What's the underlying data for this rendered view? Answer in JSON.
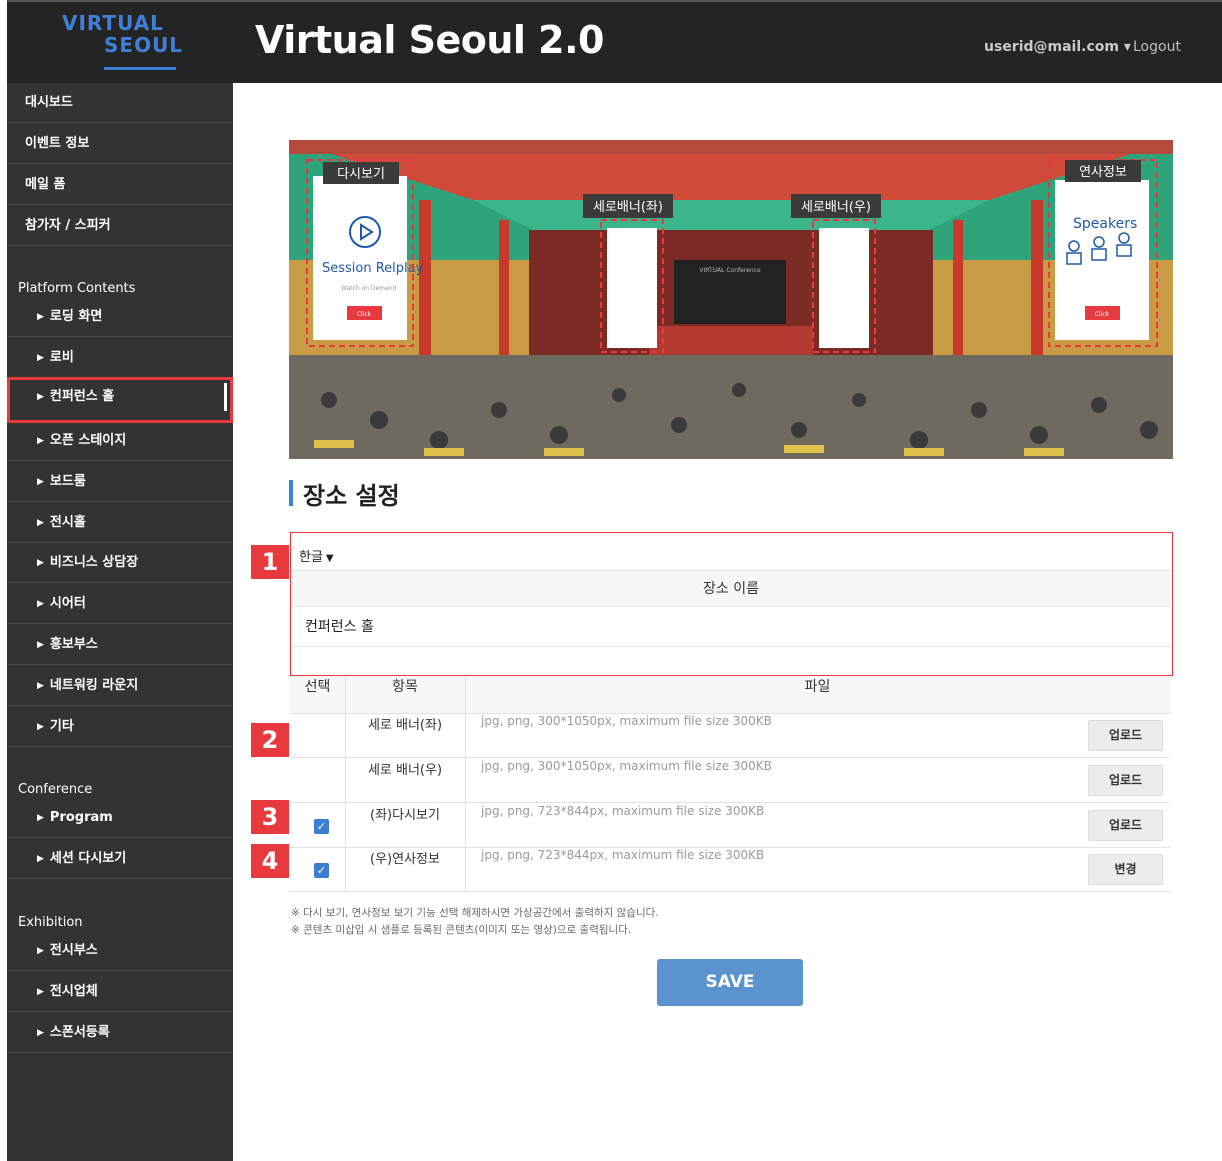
{
  "header": {
    "logo_line1": "VIRTUAL",
    "logo_line2": "SEOUL",
    "title": "Virtual Seoul 2.0",
    "user": "userid@mail.com ▾",
    "logout": "Logout"
  },
  "sidebar": {
    "top_items": [
      "대시보드",
      "이벤트 정보",
      "메일 폼",
      "참가자 / 스피커"
    ],
    "sections": [
      "Platform Contents",
      "Conference",
      "Exhibition"
    ],
    "platform_items": [
      "로딩 화면",
      "로비",
      "컨퍼런스 홀",
      "오픈 스테이지",
      "보드룸",
      "전시홀",
      "비즈니스 상담장",
      "시어터",
      "홍보부스",
      "네트워킹 라운지",
      "기타"
    ],
    "conference_items": [
      "Program",
      "세션 다시보기"
    ],
    "exhibition_items": [
      "전시부스",
      "전시업체",
      "스폰서등록"
    ],
    "active_item": "컨퍼런스 홀"
  },
  "banner": {
    "left_label": "다시보기",
    "right_label": "연사정보",
    "banner_left_label": "세로배너(좌)",
    "banner_right_label": "세로배너(우)",
    "replay_text": "Session Relplay",
    "replay_sub": "Watch on Demand",
    "click": "Click",
    "speakers_text": "Speakers",
    "screen_text": "VIRTUAL Conference"
  },
  "page": {
    "heading": "장소 설정",
    "language": "한글",
    "name_header": "장소 이름",
    "name_value": "컨퍼런스 홀"
  },
  "markers": [
    "1",
    "2",
    "3",
    "4"
  ],
  "table": {
    "headers": [
      "선택",
      "항목",
      "파일"
    ],
    "rows": [
      {
        "item": "세로 배너(좌)",
        "file": "jpg, png, 300*1050px, maximum file size 300KB",
        "button": "업로드",
        "checked": false
      },
      {
        "item": "세로 배너(우)",
        "file": "jpg, png, 300*1050px, maximum file size 300KB",
        "button": "업로드",
        "checked": false
      },
      {
        "item": "(좌)다시보기",
        "file": "jpg, png, 723*844px, maximum file size 300KB",
        "button": "업로드",
        "checked": true
      },
      {
        "item": "(우)연사정보",
        "file": "jpg, png, 723*844px, maximum file size 300KB",
        "button": "변경",
        "checked": true
      }
    ]
  },
  "notes": [
    "※  다시 보기, 연사정보 보기 기능 선택 해제하시면 가상공간에서 출력하지 않습니다.",
    "※  콘텐츠 미삽입 시 샘플로 등록된 콘텐츠(이미지 또는 영상)으로 출력됩니다."
  ],
  "save_label": "SAVE",
  "colors": {
    "accent": "#3f7fd6",
    "highlight": "#e8393f",
    "sidebar_bg": "#333333",
    "header_bg": "#242424",
    "save_bg": "#5b93cf"
  }
}
